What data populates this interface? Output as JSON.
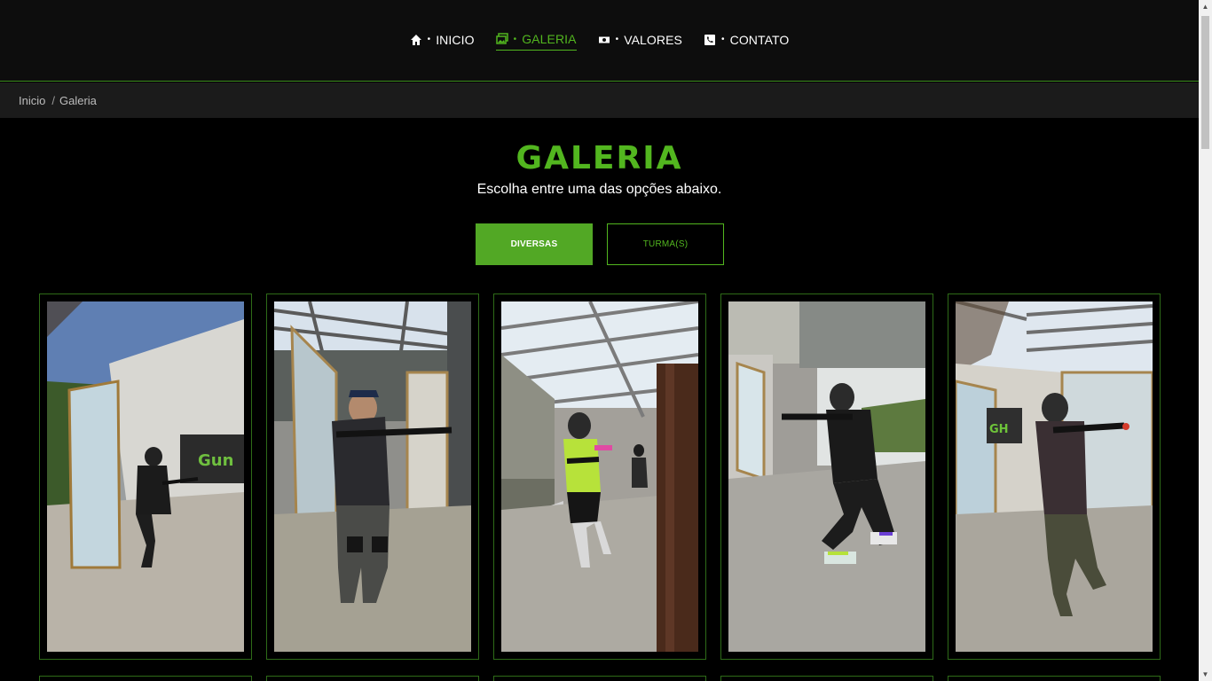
{
  "nav": {
    "items": [
      {
        "label": "INICIO",
        "icon": "home-icon"
      },
      {
        "label": "GALERIA",
        "icon": "images-icon",
        "active": true
      },
      {
        "label": "VALORES",
        "icon": "money-icon"
      },
      {
        "label": "CONTATO",
        "icon": "phone-icon"
      }
    ],
    "separator": "•"
  },
  "breadcrumb": {
    "home": "Inicio",
    "separator": "/",
    "current": "Galeria"
  },
  "main": {
    "title": "GALERIA",
    "subtitle": "Escolha entre uma das opções abaixo.",
    "filters": [
      {
        "label": "DIVERSAS",
        "selected": true
      },
      {
        "label": "TURMA(S)",
        "selected": false
      }
    ]
  },
  "gallery": {
    "photos": [
      "player-in-glass-booth",
      "player-with-rifle-in-booth",
      "players-near-barrels",
      "player-crouched-with-rifle",
      "player-aiming-in-booth"
    ]
  },
  "colors": {
    "accent": "#52b61f",
    "navbar_bg": "#0d0d0d",
    "crumb_bg": "#1b1b1b",
    "page_bg": "#000000"
  }
}
